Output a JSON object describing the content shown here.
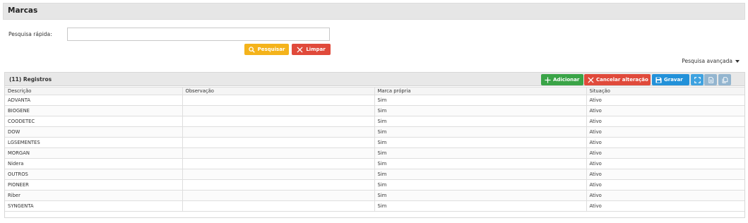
{
  "title": "Marcas",
  "search": {
    "label": "Pesquisa rápida:",
    "value": "",
    "search_button": "Pesquisar",
    "clear_button": "Limpar"
  },
  "advanced_search": "Pesquisa avançada",
  "grid": {
    "count_label": "(11) Registros",
    "toolbar": {
      "add": "Adicionar",
      "cancel": "Cancelar alteração",
      "save": "Gravar"
    },
    "columns": [
      "Descrição",
      "Observação",
      "Marca própria",
      "Situação"
    ],
    "rows": [
      [
        "ADVANTA",
        "",
        "Sim",
        "Ativo"
      ],
      [
        "BIOGENE",
        "",
        "Sim",
        "Ativo"
      ],
      [
        "COODETEC",
        "",
        "Sim",
        "Ativo"
      ],
      [
        "DOW",
        "",
        "Sim",
        "Ativo"
      ],
      [
        "LGSEMENTES",
        "",
        "Sim",
        "Ativo"
      ],
      [
        "MORGAN",
        "",
        "Sim",
        "Ativo"
      ],
      [
        "Nidera",
        "",
        "Sim",
        "Ativo"
      ],
      [
        "OUTROS",
        "",
        "Sim",
        "Ativo"
      ],
      [
        "PIONEER",
        "",
        "Sim",
        "Ativo"
      ],
      [
        "Riber",
        "",
        "Sim",
        "Ativo"
      ],
      [
        "SYNGENTA",
        "",
        "Sim",
        "Ativo"
      ]
    ]
  },
  "colors": {
    "search": "#f4b31b",
    "clear": "#e04a3b",
    "add": "#3aa447",
    "cancel": "#e04a3b",
    "save": "#2291d9",
    "expand": "#3ea2e0",
    "disabled": "#93b5cf"
  }
}
